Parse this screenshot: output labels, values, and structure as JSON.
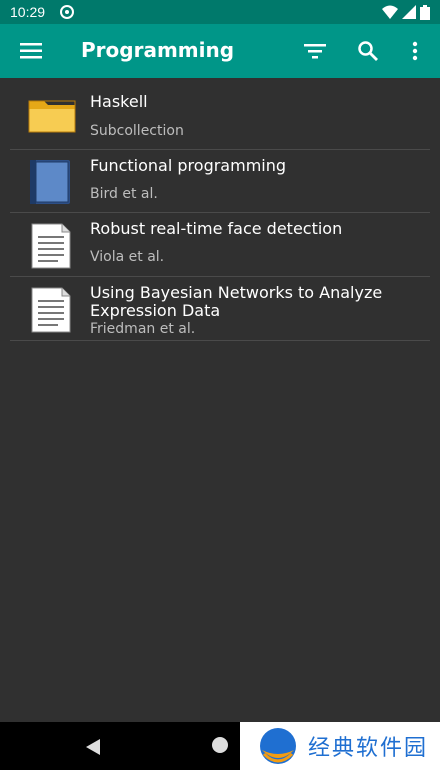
{
  "status_bar": {
    "time": "10:29",
    "icons": [
      "sync-icon",
      "wifi-icon",
      "signal-icon",
      "battery-icon"
    ]
  },
  "app_bar": {
    "title": "Programming",
    "actions": [
      "menu-icon",
      "filter-icon",
      "search-icon",
      "more-vert-icon"
    ]
  },
  "items": [
    {
      "title": "Haskell",
      "subtitle": "Subcollection",
      "icon": "folder-icon"
    },
    {
      "title": "Functional programming",
      "subtitle": "Bird et al.",
      "icon": "book-icon"
    },
    {
      "title": "Robust real-time face detection",
      "subtitle": "Viola et al.",
      "icon": "document-icon"
    },
    {
      "title": "Using Bayesian Networks to Analyze Expression Data",
      "subtitle": "Friedman et al.",
      "icon": "document-icon"
    }
  ],
  "nav_bar": {
    "buttons": [
      "back-icon",
      "home-icon"
    ]
  },
  "watermark": {
    "text": "经典软件园"
  },
  "colors": {
    "status_bar": "#00796b",
    "app_bar": "#009688",
    "background": "#303030"
  }
}
